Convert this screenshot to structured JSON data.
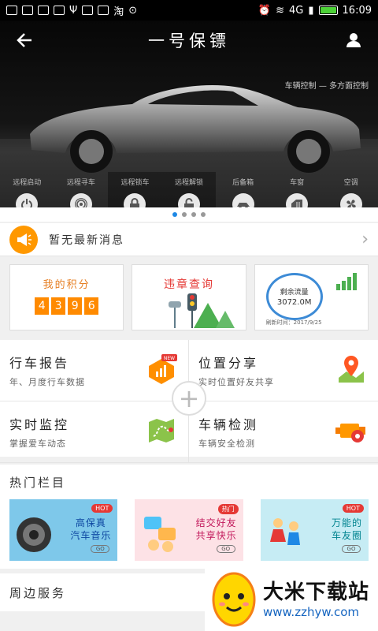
{
  "status_bar": {
    "time": "16:09",
    "network": "4G"
  },
  "header": {
    "title": "一号保镖"
  },
  "hero": {
    "tagline": "车辆控制 — 多方面控制"
  },
  "controls": [
    {
      "label": "远程启动",
      "icon": "power-icon"
    },
    {
      "label": "远程寻车",
      "icon": "signal-icon"
    },
    {
      "label": "远程锁车",
      "icon": "lock-icon"
    },
    {
      "label": "远程解锁",
      "icon": "unlock-icon"
    },
    {
      "label": "后备箱",
      "icon": "trunk-icon"
    },
    {
      "label": "车窗",
      "icon": "window-icon"
    },
    {
      "label": "空调",
      "icon": "fan-icon"
    }
  ],
  "news": {
    "text": "暂无最新消息"
  },
  "cards": {
    "points": {
      "title": "我的积分",
      "digits": [
        "4",
        "3",
        "9",
        "6"
      ]
    },
    "violation": {
      "title": "违章查询"
    },
    "traffic": {
      "label": "剩余流量",
      "value": "3072.0M",
      "updated": "刷新时间：2017/9/25"
    }
  },
  "grid": [
    {
      "title": "行车报告",
      "sub": "年、月度行车数据",
      "badge": "NEW"
    },
    {
      "title": "位置分享",
      "sub": "实时位置好友共享"
    },
    {
      "title": "实时监控",
      "sub": "掌握爱车动态"
    },
    {
      "title": "车辆检测",
      "sub": "车辆安全检测"
    }
  ],
  "hot": {
    "title": "热门栏目",
    "items": [
      {
        "badge": "HOT",
        "line1": "高保真",
        "line2": "汽车音乐",
        "go": "GO"
      },
      {
        "badge": "热门",
        "line1": "结交好友",
        "line2": "共享快乐",
        "go": "GO"
      },
      {
        "badge": "HOT",
        "line1": "万能的",
        "line2": "车友圈",
        "go": "GO"
      }
    ]
  },
  "nearby": {
    "title": "周边服务"
  },
  "watermark": {
    "title": "大米下载站",
    "url": "www.zzhyw.com"
  },
  "colors": {
    "accent": "#ff9800",
    "blue": "#1e88e5"
  }
}
